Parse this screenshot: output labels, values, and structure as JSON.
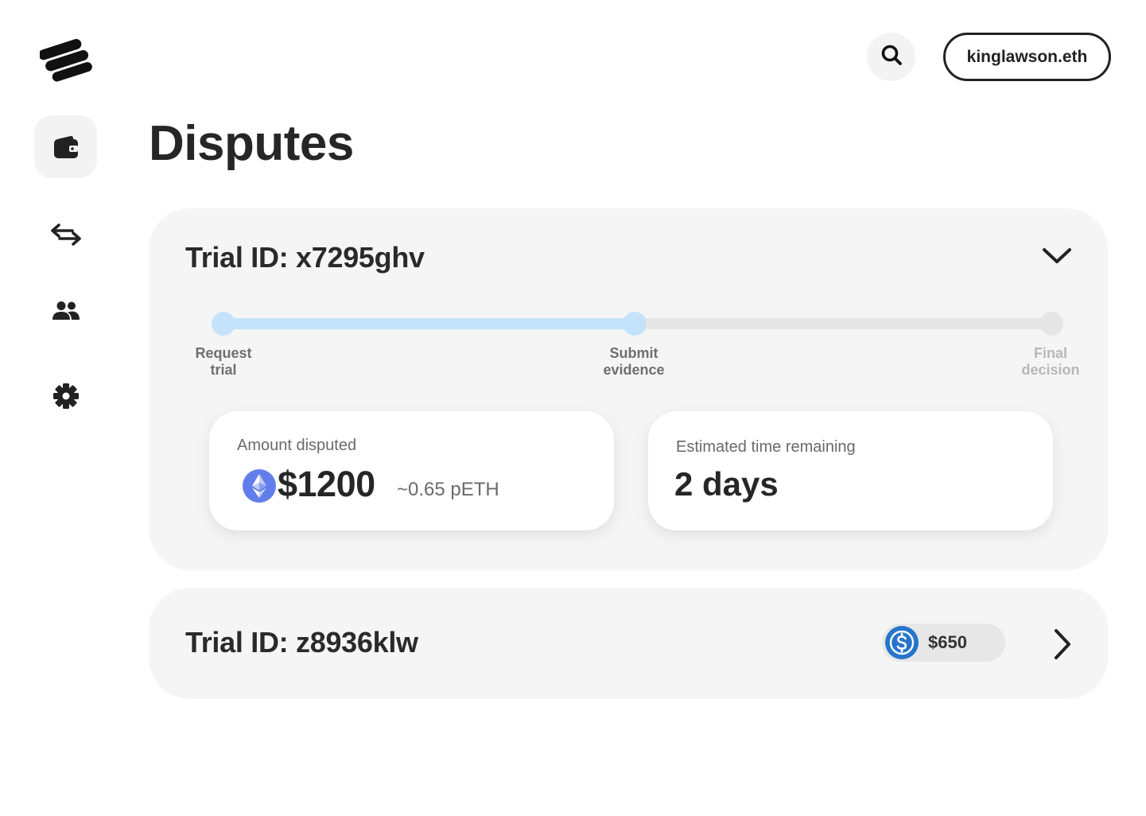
{
  "header": {
    "account_label": "kinglawson.eth",
    "search_icon": "search-icon"
  },
  "sidebar": {
    "items": [
      {
        "name": "wallet",
        "icon": "wallet-icon",
        "active": true
      },
      {
        "name": "transfers",
        "icon": "swap-arrows-icon",
        "active": false
      },
      {
        "name": "users",
        "icon": "people-icon",
        "active": false
      },
      {
        "name": "settings",
        "icon": "gear-icon",
        "active": false
      }
    ]
  },
  "page": {
    "title": "Disputes"
  },
  "disputes": [
    {
      "trial_id": "Trial ID: x7295ghv",
      "expanded": true,
      "progress_fraction": 0.5,
      "steps": [
        {
          "line1": "Request",
          "line2": "trial",
          "done": true
        },
        {
          "line1": "Submit",
          "line2": "evidence",
          "done": true
        },
        {
          "line1": "Final",
          "line2": "decision",
          "done": false
        }
      ],
      "amount_label": "Amount disputed",
      "amount_value": "$1200",
      "amount_secondary": "~0.65 pETH",
      "amount_token_icon": "ethereum-icon",
      "time_label": "Estimated time remaining",
      "time_value": "2 days"
    },
    {
      "trial_id": "Trial ID: z8936klw",
      "expanded": false,
      "pill_value": "$650",
      "pill_token_icon": "usdc-icon"
    }
  ],
  "colors": {
    "progress_done": "#c4e3fa",
    "progress_todo": "#e6e6e6",
    "eth_icon": "#627eea",
    "usdc_icon": "#2775ca",
    "card_background": "#f5f5f5"
  }
}
